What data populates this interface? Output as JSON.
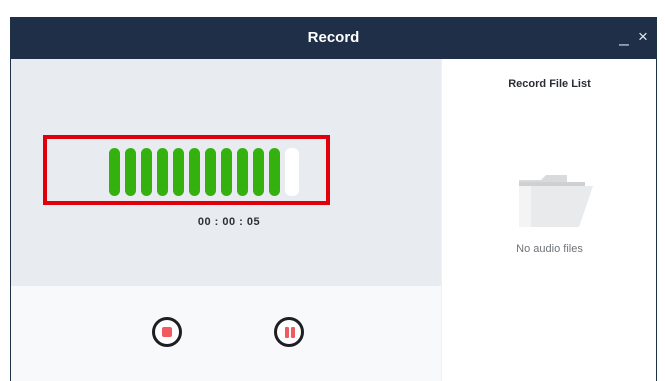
{
  "window": {
    "title": "Record",
    "minimize_icon": "minimize-icon",
    "close_icon": "close-icon",
    "minimize_label": "_",
    "close_label": "×"
  },
  "recorder": {
    "level_segments_total": 12,
    "level_segments_active": 11,
    "level_color": "#35b10f",
    "highlight_color": "#e0000c",
    "elapsed_time": "00 : 00 : 05",
    "stop_icon": "stop-icon",
    "pause_icon": "pause-icon",
    "control_accent": "#f15a5f"
  },
  "file_list": {
    "title": "Record File List",
    "empty_icon": "folder-icon",
    "empty_text": "No audio files"
  },
  "colors": {
    "titlebar": "#1e2f47",
    "panel_bg": "#e8ebef"
  }
}
